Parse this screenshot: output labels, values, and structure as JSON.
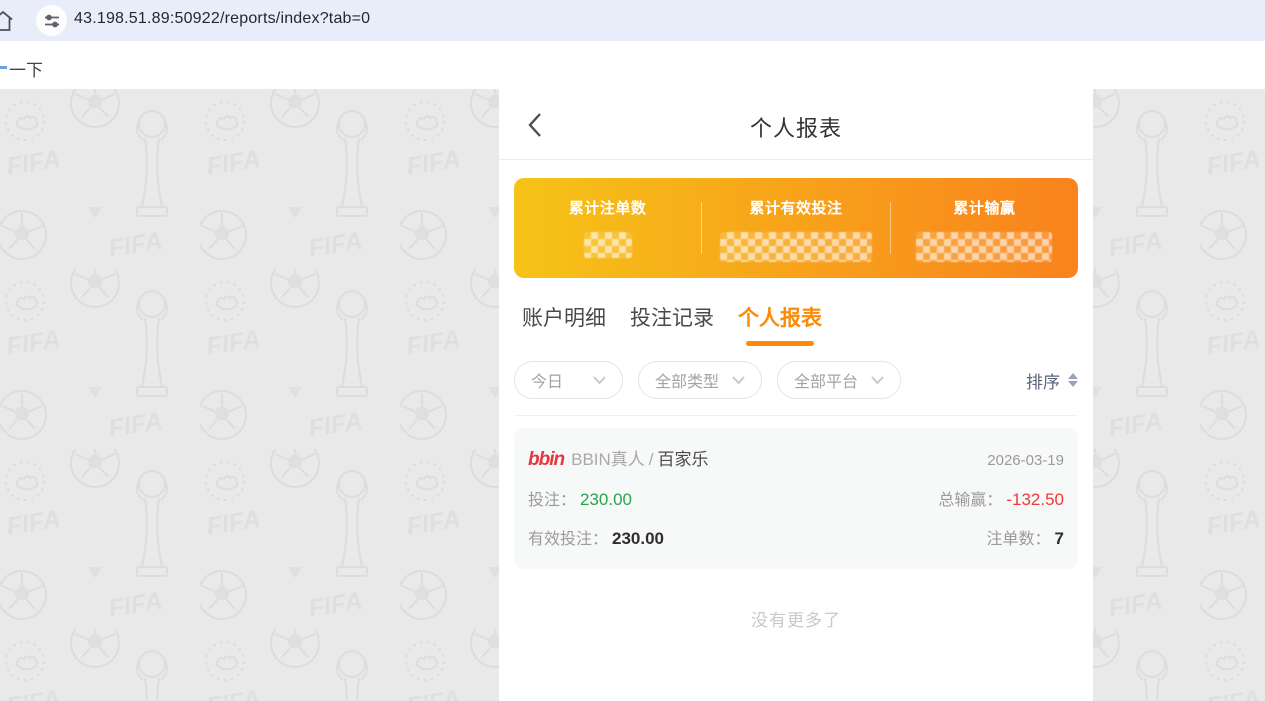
{
  "browser": {
    "url": "43.198.51.89:50922/reports/index?tab=0",
    "bookmark_fragment": "一下"
  },
  "page": {
    "title": "个人报表"
  },
  "summary": {
    "items": [
      {
        "label": "累计注单数",
        "value": "",
        "censored": true
      },
      {
        "label": "累计有效投注",
        "value": "",
        "censored": true
      },
      {
        "label": "累计输赢",
        "value": "",
        "censored": true
      }
    ]
  },
  "tabs": [
    {
      "label": "账户明细",
      "active": false
    },
    {
      "label": "投注记录",
      "active": false
    },
    {
      "label": "个人报表",
      "active": true
    }
  ],
  "filters": {
    "dropdowns": [
      {
        "label": "今日"
      },
      {
        "label": "全部类型"
      },
      {
        "label": "全部平台"
      }
    ],
    "sort_label": "排序"
  },
  "report": {
    "provider_logo_text": "bbin",
    "provider": "BBIN真人",
    "separator": "/",
    "game": "百家乐",
    "date": "2026-03-19",
    "bet_label": "投注：",
    "bet_value": "230.00",
    "winloss_label": "总输赢：",
    "winloss_value": "-132.50",
    "valid_bet_label": "有效投注：",
    "valid_bet_value": "230.00",
    "count_label": "注单数：",
    "count_value": "7"
  },
  "footer": {
    "no_more": "没有更多了"
  },
  "colors": {
    "accent_orange": "#ff8a05",
    "gradient_start": "#f6c318",
    "gradient_end": "#f9821d",
    "positive_green": "#2aa34f",
    "negative_red": "#ed3b3b",
    "bbin_red": "#e1393f",
    "topbar_lavender": "#e9edf9",
    "page_gray": "#e9e9e9"
  }
}
